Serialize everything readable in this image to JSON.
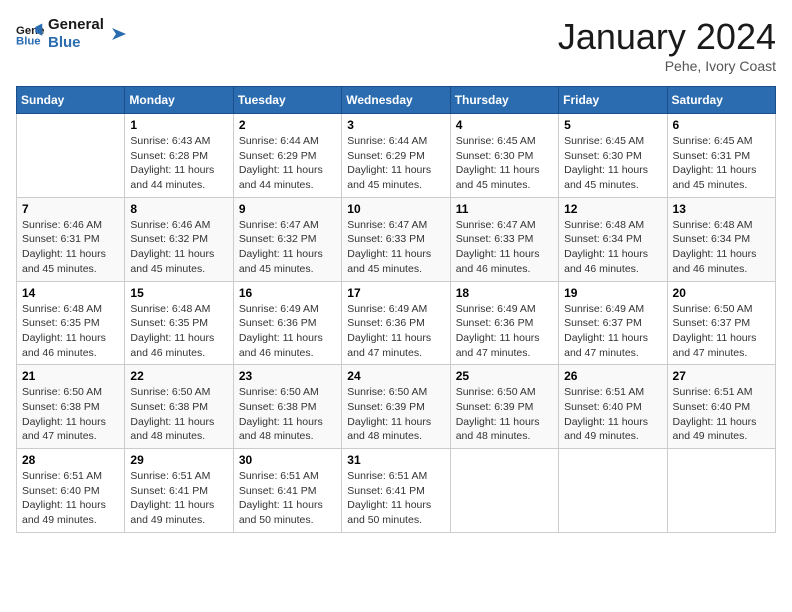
{
  "header": {
    "logo_line1": "General",
    "logo_line2": "Blue",
    "title": "January 2024",
    "subtitle": "Pehe, Ivory Coast"
  },
  "days_of_week": [
    "Sunday",
    "Monday",
    "Tuesday",
    "Wednesday",
    "Thursday",
    "Friday",
    "Saturday"
  ],
  "weeks": [
    [
      {
        "day": "",
        "detail": ""
      },
      {
        "day": "1",
        "detail": "Sunrise: 6:43 AM\nSunset: 6:28 PM\nDaylight: 11 hours\nand 44 minutes."
      },
      {
        "day": "2",
        "detail": "Sunrise: 6:44 AM\nSunset: 6:29 PM\nDaylight: 11 hours\nand 44 minutes."
      },
      {
        "day": "3",
        "detail": "Sunrise: 6:44 AM\nSunset: 6:29 PM\nDaylight: 11 hours\nand 45 minutes."
      },
      {
        "day": "4",
        "detail": "Sunrise: 6:45 AM\nSunset: 6:30 PM\nDaylight: 11 hours\nand 45 minutes."
      },
      {
        "day": "5",
        "detail": "Sunrise: 6:45 AM\nSunset: 6:30 PM\nDaylight: 11 hours\nand 45 minutes."
      },
      {
        "day": "6",
        "detail": "Sunrise: 6:45 AM\nSunset: 6:31 PM\nDaylight: 11 hours\nand 45 minutes."
      }
    ],
    [
      {
        "day": "7",
        "detail": "Sunrise: 6:46 AM\nSunset: 6:31 PM\nDaylight: 11 hours\nand 45 minutes."
      },
      {
        "day": "8",
        "detail": "Sunrise: 6:46 AM\nSunset: 6:32 PM\nDaylight: 11 hours\nand 45 minutes."
      },
      {
        "day": "9",
        "detail": "Sunrise: 6:47 AM\nSunset: 6:32 PM\nDaylight: 11 hours\nand 45 minutes."
      },
      {
        "day": "10",
        "detail": "Sunrise: 6:47 AM\nSunset: 6:33 PM\nDaylight: 11 hours\nand 45 minutes."
      },
      {
        "day": "11",
        "detail": "Sunrise: 6:47 AM\nSunset: 6:33 PM\nDaylight: 11 hours\nand 46 minutes."
      },
      {
        "day": "12",
        "detail": "Sunrise: 6:48 AM\nSunset: 6:34 PM\nDaylight: 11 hours\nand 46 minutes."
      },
      {
        "day": "13",
        "detail": "Sunrise: 6:48 AM\nSunset: 6:34 PM\nDaylight: 11 hours\nand 46 minutes."
      }
    ],
    [
      {
        "day": "14",
        "detail": "Sunrise: 6:48 AM\nSunset: 6:35 PM\nDaylight: 11 hours\nand 46 minutes."
      },
      {
        "day": "15",
        "detail": "Sunrise: 6:48 AM\nSunset: 6:35 PM\nDaylight: 11 hours\nand 46 minutes."
      },
      {
        "day": "16",
        "detail": "Sunrise: 6:49 AM\nSunset: 6:36 PM\nDaylight: 11 hours\nand 46 minutes."
      },
      {
        "day": "17",
        "detail": "Sunrise: 6:49 AM\nSunset: 6:36 PM\nDaylight: 11 hours\nand 47 minutes."
      },
      {
        "day": "18",
        "detail": "Sunrise: 6:49 AM\nSunset: 6:36 PM\nDaylight: 11 hours\nand 47 minutes."
      },
      {
        "day": "19",
        "detail": "Sunrise: 6:49 AM\nSunset: 6:37 PM\nDaylight: 11 hours\nand 47 minutes."
      },
      {
        "day": "20",
        "detail": "Sunrise: 6:50 AM\nSunset: 6:37 PM\nDaylight: 11 hours\nand 47 minutes."
      }
    ],
    [
      {
        "day": "21",
        "detail": "Sunrise: 6:50 AM\nSunset: 6:38 PM\nDaylight: 11 hours\nand 47 minutes."
      },
      {
        "day": "22",
        "detail": "Sunrise: 6:50 AM\nSunset: 6:38 PM\nDaylight: 11 hours\nand 48 minutes."
      },
      {
        "day": "23",
        "detail": "Sunrise: 6:50 AM\nSunset: 6:38 PM\nDaylight: 11 hours\nand 48 minutes."
      },
      {
        "day": "24",
        "detail": "Sunrise: 6:50 AM\nSunset: 6:39 PM\nDaylight: 11 hours\nand 48 minutes."
      },
      {
        "day": "25",
        "detail": "Sunrise: 6:50 AM\nSunset: 6:39 PM\nDaylight: 11 hours\nand 48 minutes."
      },
      {
        "day": "26",
        "detail": "Sunrise: 6:51 AM\nSunset: 6:40 PM\nDaylight: 11 hours\nand 49 minutes."
      },
      {
        "day": "27",
        "detail": "Sunrise: 6:51 AM\nSunset: 6:40 PM\nDaylight: 11 hours\nand 49 minutes."
      }
    ],
    [
      {
        "day": "28",
        "detail": "Sunrise: 6:51 AM\nSunset: 6:40 PM\nDaylight: 11 hours\nand 49 minutes."
      },
      {
        "day": "29",
        "detail": "Sunrise: 6:51 AM\nSunset: 6:41 PM\nDaylight: 11 hours\nand 49 minutes."
      },
      {
        "day": "30",
        "detail": "Sunrise: 6:51 AM\nSunset: 6:41 PM\nDaylight: 11 hours\nand 50 minutes."
      },
      {
        "day": "31",
        "detail": "Sunrise: 6:51 AM\nSunset: 6:41 PM\nDaylight: 11 hours\nand 50 minutes."
      },
      {
        "day": "",
        "detail": ""
      },
      {
        "day": "",
        "detail": ""
      },
      {
        "day": "",
        "detail": ""
      }
    ]
  ]
}
